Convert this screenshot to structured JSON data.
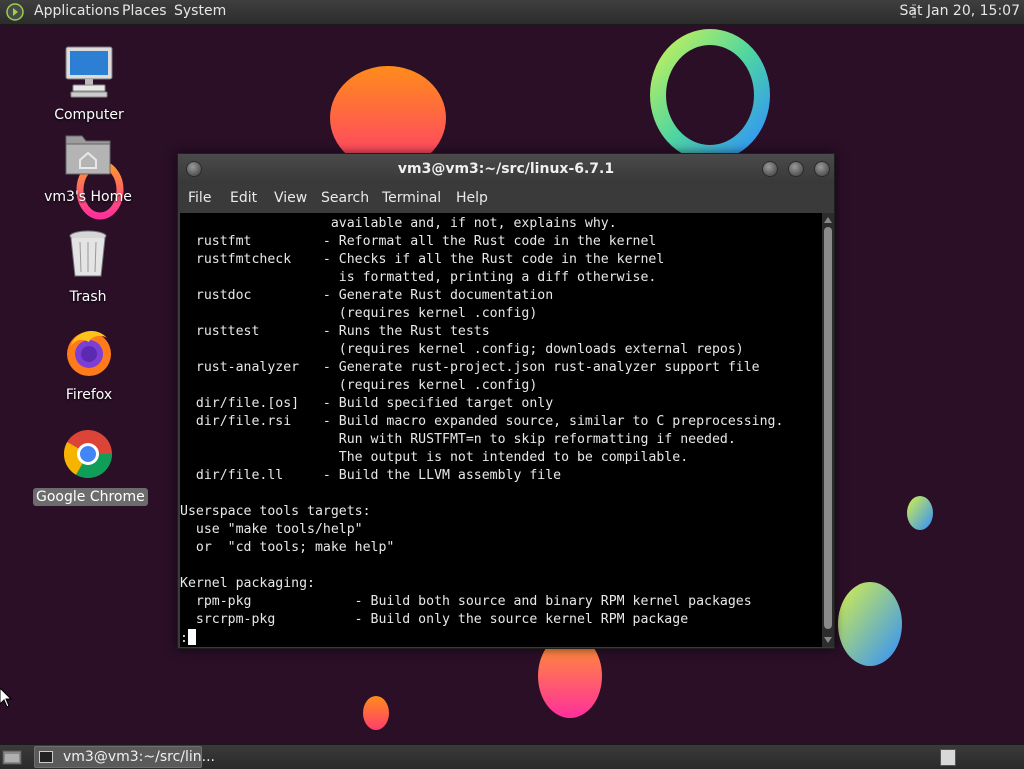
{
  "top_panel": {
    "menus": [
      "Applications",
      "Places",
      "System"
    ],
    "clock": "Sat Jan 20, 15:07"
  },
  "desktop": {
    "icons": [
      {
        "label": "Computer",
        "icon": "computer-icon"
      },
      {
        "label": "vm3's Home",
        "icon": "home-folder-icon"
      },
      {
        "label": "Trash",
        "icon": "trash-icon"
      },
      {
        "label": "Firefox",
        "icon": "firefox-icon"
      },
      {
        "label": "Google Chrome",
        "icon": "chrome-icon"
      }
    ]
  },
  "terminal": {
    "title": "vm3@vm3:~/src/linux-6.7.1",
    "menu": [
      "File",
      "Edit",
      "View",
      "Search",
      "Terminal",
      "Help"
    ],
    "lines": [
      "                   available and, if not, explains why.",
      "  rustfmt         - Reformat all the Rust code in the kernel",
      "  rustfmtcheck    - Checks if all the Rust code in the kernel",
      "                    is formatted, printing a diff otherwise.",
      "  rustdoc         - Generate Rust documentation",
      "                    (requires kernel .config)",
      "  rusttest        - Runs the Rust tests",
      "                    (requires kernel .config; downloads external repos)",
      "  rust-analyzer   - Generate rust-project.json rust-analyzer support file",
      "                    (requires kernel .config)",
      "  dir/file.[os]   - Build specified target only",
      "  dir/file.rsi    - Build macro expanded source, similar to C preprocessing.",
      "                    Run with RUSTFMT=n to skip reformatting if needed.",
      "                    The output is not intended to be compilable.",
      "  dir/file.ll     - Build the LLVM assembly file",
      "",
      "Userspace tools targets:",
      "  use \"make tools/help\"",
      "  or  \"cd tools; make help\"",
      "",
      "Kernel packaging:",
      "  rpm-pkg             - Build both source and binary RPM kernel packages",
      "  srcrpm-pkg          - Build only the source kernel RPM package"
    ],
    "prompt": ":"
  },
  "bottom_panel": {
    "task_label": "vm3@vm3:~/src/lin..."
  },
  "colors": {
    "desktop_bg": "#2a0f27",
    "panel_bg": "#333333",
    "terminal_bg": "#000000",
    "terminal_fg": "#e8e8e8"
  }
}
